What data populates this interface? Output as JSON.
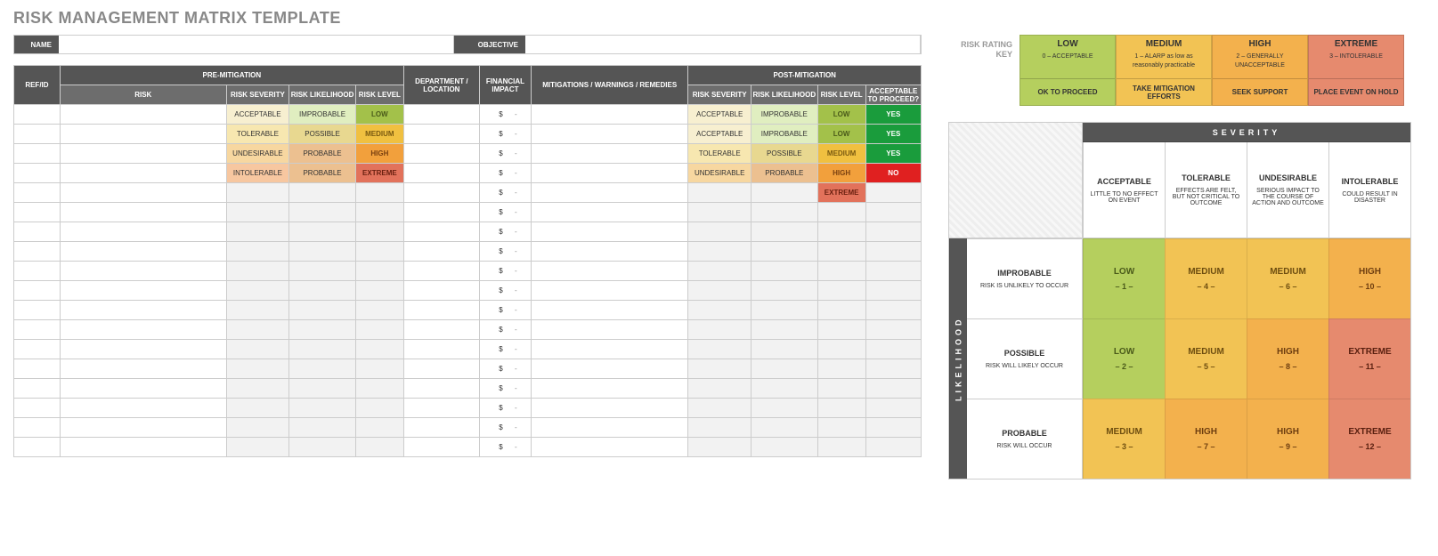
{
  "title": "RISK MANAGEMENT MATRIX TEMPLATE",
  "header": {
    "name_label": "NAME",
    "objective_label": "OBJECTIVE"
  },
  "table": {
    "cols": {
      "refid": "REF/ID",
      "pre": "PRE-MITIGATION",
      "risk": "RISK",
      "sev": "RISK SEVERITY",
      "lik": "RISK LIKELIHOOD",
      "lvl": "RISK LEVEL",
      "dept": "DEPARTMENT / LOCATION",
      "fin": "FINANCIAL IMPACT",
      "mit": "MITIGATIONS / WARNINGS / REMEDIES",
      "post": "POST-MITIGATION",
      "ok": "ACCEPTABLE TO PROCEED?"
    },
    "dollar": "$",
    "dash": "-",
    "rows": [
      {
        "pre_sev": "ACCEPTABLE",
        "pre_sev_c": "c-accept",
        "pre_lik": "IMPROBABLE",
        "pre_lik_c": "c-improb",
        "pre_lvl": "LOW",
        "pre_lvl_c": "c-low",
        "post_sev": "ACCEPTABLE",
        "post_sev_c": "c-accept",
        "post_lik": "IMPROBABLE",
        "post_lik_c": "c-improb",
        "post_lvl": "LOW",
        "post_lvl_c": "c-low",
        "ok": "YES",
        "ok_c": "c-yes"
      },
      {
        "pre_sev": "TOLERABLE",
        "pre_sev_c": "c-toler",
        "pre_lik": "POSSIBLE",
        "pre_lik_c": "c-poss",
        "pre_lvl": "MEDIUM",
        "pre_lvl_c": "c-medium",
        "post_sev": "ACCEPTABLE",
        "post_sev_c": "c-accept",
        "post_lik": "IMPROBABLE",
        "post_lik_c": "c-improb",
        "post_lvl": "LOW",
        "post_lvl_c": "c-low",
        "ok": "YES",
        "ok_c": "c-yes"
      },
      {
        "pre_sev": "UNDESIRABLE",
        "pre_sev_c": "c-undes",
        "pre_lik": "PROBABLE",
        "pre_lik_c": "c-prob",
        "pre_lvl": "HIGH",
        "pre_lvl_c": "c-high",
        "post_sev": "TOLERABLE",
        "post_sev_c": "c-toler",
        "post_lik": "POSSIBLE",
        "post_lik_c": "c-poss",
        "post_lvl": "MEDIUM",
        "post_lvl_c": "c-medium",
        "ok": "YES",
        "ok_c": "c-yes"
      },
      {
        "pre_sev": "INTOLERABLE",
        "pre_sev_c": "c-intol",
        "pre_lik": "PROBABLE",
        "pre_lik_c": "c-prob",
        "pre_lvl": "EXTREME",
        "pre_lvl_c": "c-extreme",
        "post_sev": "UNDESIRABLE",
        "post_sev_c": "c-undes",
        "post_lik": "PROBABLE",
        "post_lik_c": "c-prob",
        "post_lvl": "HIGH",
        "post_lvl_c": "c-high",
        "ok": "NO",
        "ok_c": "c-no"
      },
      {
        "post_lvl": "EXTREME",
        "post_lvl_c": "c-extreme"
      },
      {},
      {},
      {},
      {},
      {},
      {},
      {},
      {},
      {},
      {},
      {},
      {},
      {}
    ]
  },
  "key": {
    "label": "RISK RATING KEY",
    "boxes": [
      {
        "cls": "kb-low",
        "title": "LOW",
        "sub": "0 – ACCEPTABLE",
        "action": "OK TO PROCEED"
      },
      {
        "cls": "kb-med",
        "title": "MEDIUM",
        "sub": "1 – ALARP as low as reasonably practicable",
        "action": "TAKE MITIGATION EFFORTS"
      },
      {
        "cls": "kb-high",
        "title": "HIGH",
        "sub": "2 – GENERALLY UNACCEPTABLE",
        "action": "SEEK SUPPORT"
      },
      {
        "cls": "kb-ext",
        "title": "EXTREME",
        "sub": "3 – INTOLERABLE",
        "action": "PLACE EVENT ON HOLD"
      }
    ]
  },
  "matrix": {
    "sev_title": "SEVERITY",
    "lik_title": "LIKELIHOOD",
    "sev": [
      {
        "name": "ACCEPTABLE",
        "desc": "LITTLE TO NO EFFECT ON EVENT"
      },
      {
        "name": "TOLERABLE",
        "desc": "EFFECTS ARE FELT, BUT NOT CRITICAL TO OUTCOME"
      },
      {
        "name": "UNDESIRABLE",
        "desc": "SERIOUS IMPACT TO THE COURSE OF ACTION AND OUTCOME"
      },
      {
        "name": "INTOLERABLE",
        "desc": "COULD RESULT IN DISASTER"
      }
    ],
    "lik": [
      {
        "name": "IMPROBABLE",
        "desc": "RISK IS UNLIKELY TO OCCUR"
      },
      {
        "name": "POSSIBLE",
        "desc": "RISK WILL LIKELY OCCUR"
      },
      {
        "name": "PROBABLE",
        "desc": "RISK WILL OCCUR"
      }
    ],
    "cells": [
      [
        {
          "lvl": "LOW",
          "num": "– 1 –",
          "c": "mc-low"
        },
        {
          "lvl": "MEDIUM",
          "num": "– 4 –",
          "c": "mc-med"
        },
        {
          "lvl": "MEDIUM",
          "num": "– 6 –",
          "c": "mc-med"
        },
        {
          "lvl": "HIGH",
          "num": "– 10 –",
          "c": "mc-high"
        }
      ],
      [
        {
          "lvl": "LOW",
          "num": "– 2 –",
          "c": "mc-low"
        },
        {
          "lvl": "MEDIUM",
          "num": "– 5 –",
          "c": "mc-med"
        },
        {
          "lvl": "HIGH",
          "num": "– 8 –",
          "c": "mc-high"
        },
        {
          "lvl": "EXTREME",
          "num": "– 11 –",
          "c": "mc-ext"
        }
      ],
      [
        {
          "lvl": "MEDIUM",
          "num": "– 3 –",
          "c": "mc-med"
        },
        {
          "lvl": "HIGH",
          "num": "– 7 –",
          "c": "mc-high"
        },
        {
          "lvl": "HIGH",
          "num": "– 9 –",
          "c": "mc-high"
        },
        {
          "lvl": "EXTREME",
          "num": "– 12 –",
          "c": "mc-ext"
        }
      ]
    ]
  },
  "chart_data": {
    "type": "heatmap",
    "title": "Risk Rating Matrix",
    "xlabel": "SEVERITY",
    "ylabel": "LIKELIHOOD",
    "x_categories": [
      "ACCEPTABLE",
      "TOLERABLE",
      "UNDESIRABLE",
      "INTOLERABLE"
    ],
    "y_categories": [
      "IMPROBABLE",
      "POSSIBLE",
      "PROBABLE"
    ],
    "values": [
      [
        1,
        4,
        6,
        10
      ],
      [
        2,
        5,
        8,
        11
      ],
      [
        3,
        7,
        9,
        12
      ]
    ],
    "levels": [
      [
        "LOW",
        "MEDIUM",
        "MEDIUM",
        "HIGH"
      ],
      [
        "LOW",
        "MEDIUM",
        "HIGH",
        "EXTREME"
      ],
      [
        "MEDIUM",
        "HIGH",
        "HIGH",
        "EXTREME"
      ]
    ],
    "legend": [
      "LOW",
      "MEDIUM",
      "HIGH",
      "EXTREME"
    ]
  }
}
